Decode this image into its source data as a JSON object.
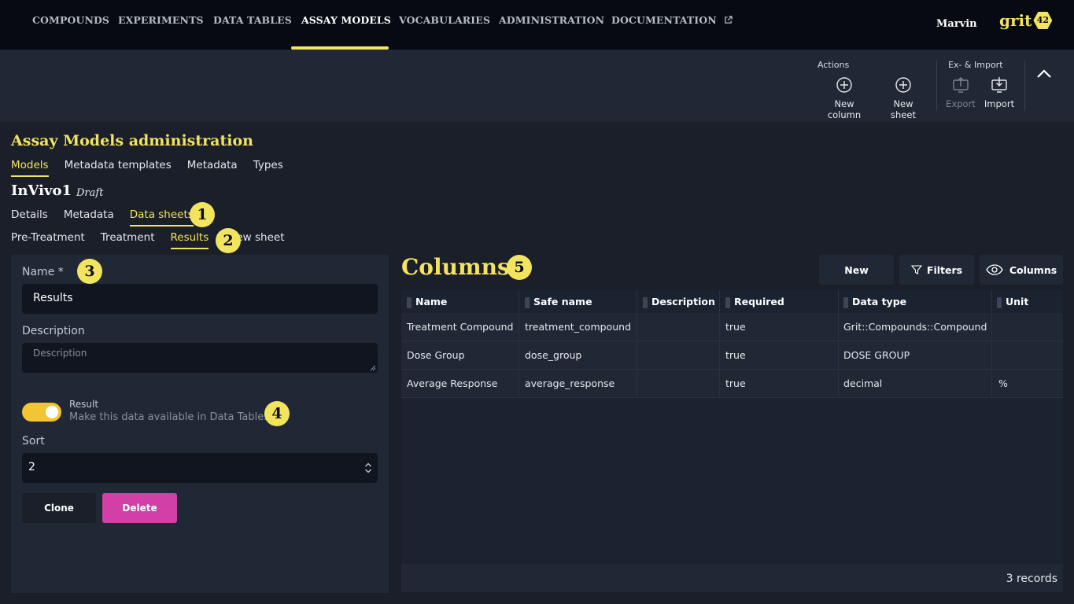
{
  "nav": {
    "items": [
      "COMPOUNDS",
      "EXPERIMENTS",
      "DATA TABLES",
      "ASSAY MODELS",
      "VOCABULARIES",
      "ADMINISTRATION",
      "DOCUMENTATION"
    ],
    "active": "ASSAY MODELS",
    "user": "Marvin",
    "logo_text": "grit",
    "logo_badge": "42"
  },
  "toolbar": {
    "actions_label": "Actions",
    "new_column": "New column",
    "new_sheet": "New sheet",
    "eximport_label": "Ex- & Import",
    "export": "Export",
    "import": "Import"
  },
  "page": {
    "title": "Assay Models administration",
    "tabs": [
      "Models",
      "Metadata templates",
      "Metadata",
      "Types"
    ],
    "active_tab": "Models"
  },
  "model": {
    "name": "InVivo1",
    "status": "Draft",
    "tabs": [
      "Details",
      "Metadata",
      "Data sheets"
    ],
    "active_tab": "Data sheets",
    "sheet_tabs": [
      "Pre-Treatment",
      "Treatment",
      "Results",
      "New sheet"
    ],
    "active_sheet": "Results"
  },
  "badges": [
    "1",
    "2",
    "3",
    "4",
    "5"
  ],
  "form": {
    "name_label": "Name *",
    "name_value": "Results",
    "description_label": "Description",
    "description_placeholder": "Description",
    "result_label": "Result",
    "result_help": "Make this data available in Data Tables",
    "result_enabled": true,
    "sort_label": "Sort",
    "sort_value": "2",
    "clone_label": "Clone",
    "delete_label": "Delete"
  },
  "columns": {
    "title": "Columns",
    "buttons": {
      "new": "New",
      "filters": "Filters",
      "columns": "Columns"
    },
    "headers": [
      "Name",
      "Safe name",
      "Description",
      "Required",
      "Data type",
      "Unit"
    ],
    "rows": [
      [
        "Treatment Compound",
        "treatment_compound",
        "",
        "true",
        "Grit::Compounds::Compound",
        ""
      ],
      [
        "Dose Group",
        "dose_group",
        "",
        "true",
        "DOSE GROUP",
        ""
      ],
      [
        "Average Response",
        "average_response",
        "",
        "true",
        "decimal",
        "%"
      ]
    ],
    "record_count": "3 records"
  },
  "colors": {
    "accent": "#f3e460",
    "toggle": "#f3c434",
    "danger": "#d23fa6",
    "nav_bg": "#070a12",
    "panel_bg": "#202836"
  }
}
